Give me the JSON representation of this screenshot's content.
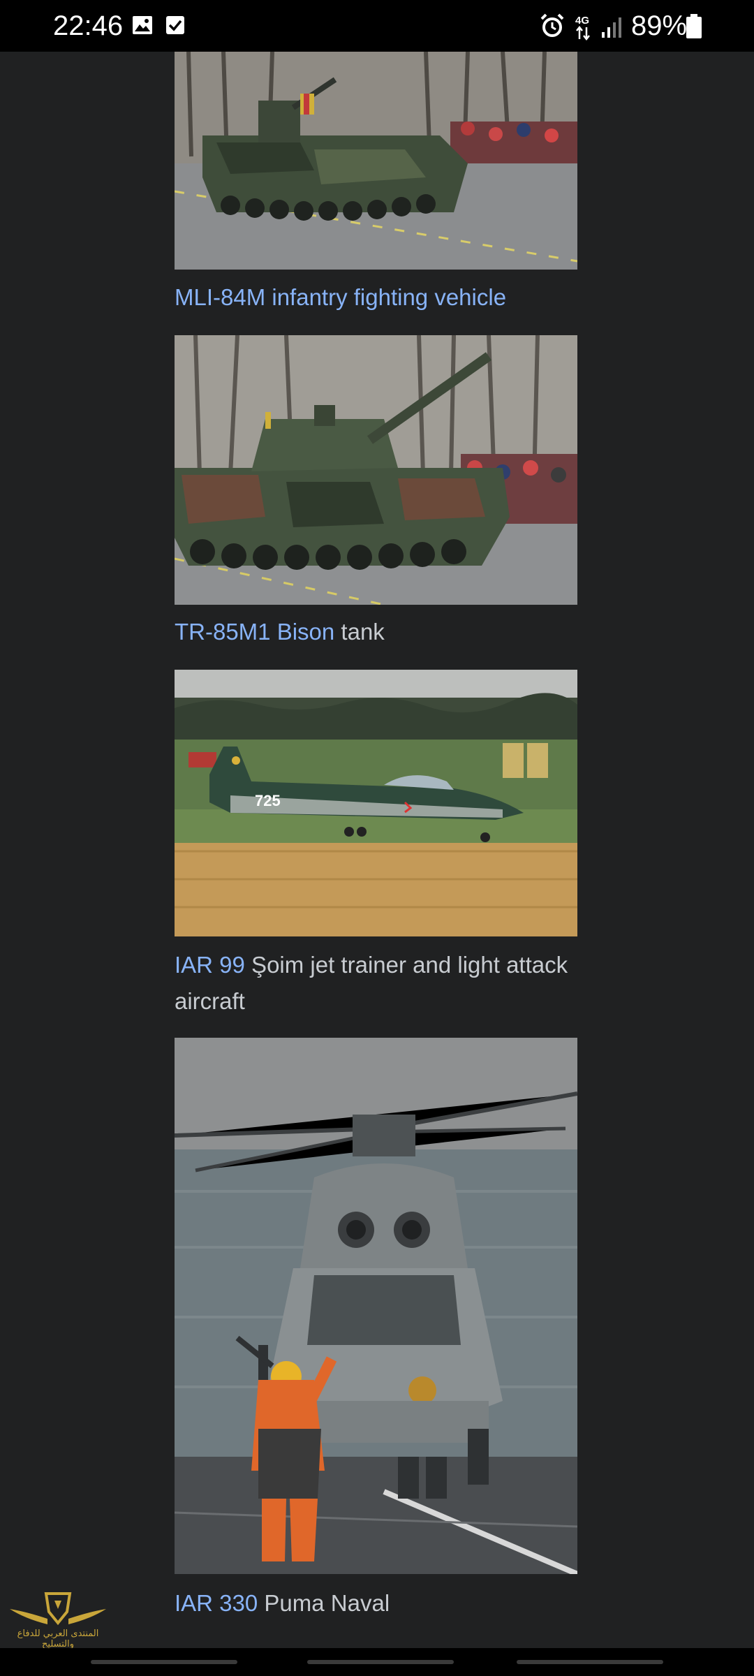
{
  "status_bar": {
    "time": "22:46",
    "left_icons": [
      "image-icon",
      "checkbox-icon"
    ],
    "right_icons": [
      "alarm-icon",
      "4g-icon",
      "signal-icon"
    ],
    "battery_percent": "89%",
    "battery_level": 0.89
  },
  "figures": [
    {
      "image_icon": "infantry-fighting-vehicle-photo",
      "caption_link": "MLI-84M infantry fighting vehicle",
      "caption_text": ""
    },
    {
      "image_icon": "tank-photo",
      "caption_link": "TR-85M1 Bison",
      "caption_text": " tank"
    },
    {
      "image_icon": "jet-trainer-photo",
      "caption_link": "IAR 99",
      "caption_text": " Şoim jet trainer and light attack aircraft"
    },
    {
      "image_icon": "helicopter-photo",
      "caption_link": "IAR 330",
      "caption_text": " Puma Naval"
    }
  ],
  "watermark": {
    "logo_icon": "shield-wings-logo",
    "text": "المنتدى العربي للدفاع والتسليح"
  },
  "colors": {
    "background": "#202122",
    "link": "#88b3f7",
    "text": "#c8ccd1"
  }
}
